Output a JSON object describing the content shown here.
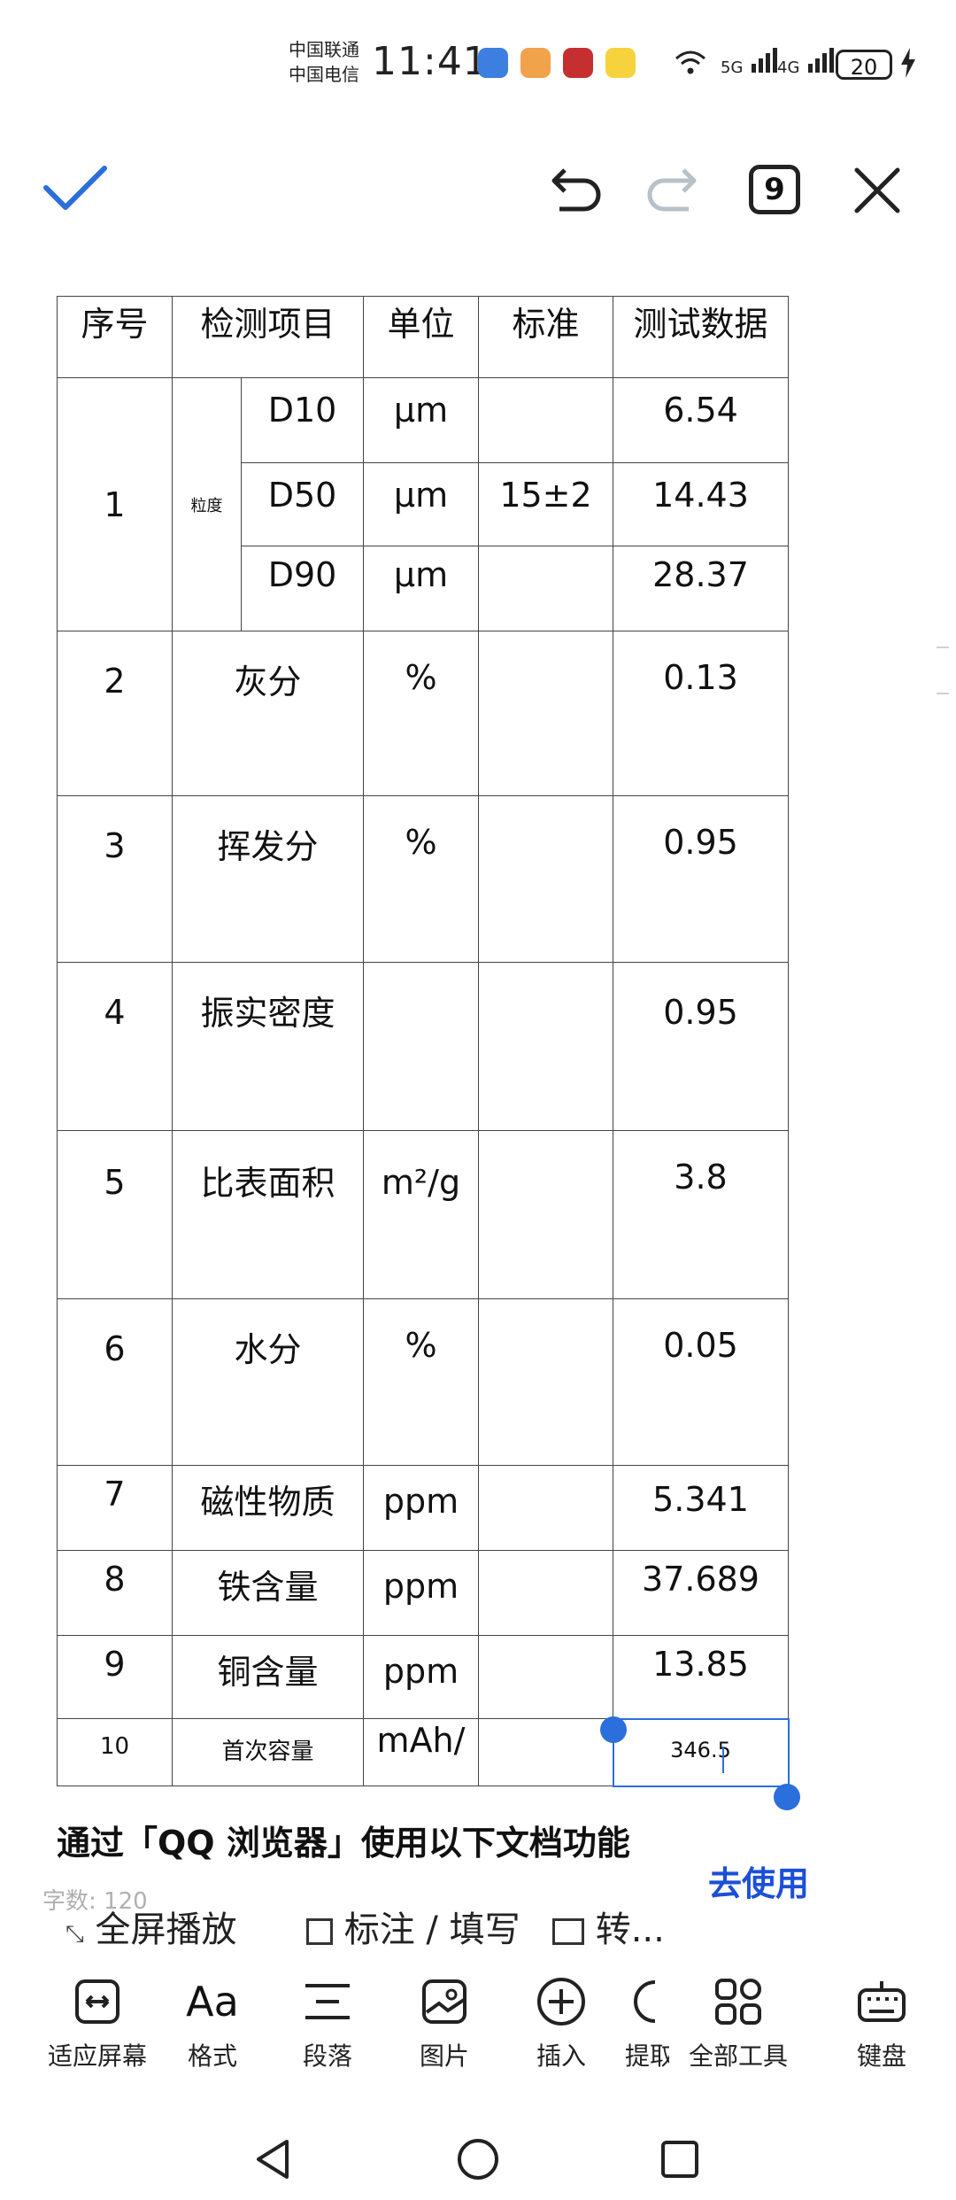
{
  "status": {
    "carrier1": "中国联通",
    "carrier2": "中国电信",
    "time": "11:41",
    "net1": "5G",
    "net2": "4G",
    "battery": "20"
  },
  "top": {
    "page_count": "9"
  },
  "table": {
    "header": [
      "序号",
      "检测项目",
      "单位",
      "标准",
      "测试数据"
    ],
    "particle_label": "粒度",
    "group1_no": "1",
    "particle_rows": [
      {
        "item": "D10",
        "unit": "μm",
        "std": "",
        "value": "6.54"
      },
      {
        "item": "D50",
        "unit": "μm",
        "std": "15±2",
        "value": "14.43"
      },
      {
        "item": "D90",
        "unit": "μm",
        "std": "",
        "value": "28.37"
      }
    ],
    "rows": [
      {
        "no": "2",
        "item": "灰分",
        "unit": "%",
        "std": "",
        "value": "0.13"
      },
      {
        "no": "3",
        "item": "挥发分",
        "unit": "%",
        "std": "",
        "value": "0.95"
      },
      {
        "no": "4",
        "item": "振实密度",
        "unit": "",
        "std": "",
        "value": "0.95"
      },
      {
        "no": "5",
        "item": "比表面积",
        "unit": "m²/g",
        "std": "",
        "value": "3.8"
      },
      {
        "no": "6",
        "item": "水分",
        "unit": "%",
        "std": "",
        "value": "0.05"
      },
      {
        "no": "7",
        "item": "磁性物质",
        "unit": "ppm",
        "std": "",
        "value": "5.341"
      },
      {
        "no": "8",
        "item": "铁含量",
        "unit": "ppm",
        "std": "",
        "value": "37.689"
      },
      {
        "no": "9",
        "item": "铜含量",
        "unit": "ppm",
        "std": "",
        "value": "13.85"
      },
      {
        "no": "10",
        "item": "首次容量",
        "unit": "mAh/",
        "std": "",
        "value": "346.5"
      }
    ]
  },
  "promo": {
    "text": "通过「QQ 浏览器」使用以下文档功能",
    "go": "去使用",
    "wordcount": "字数: 120",
    "fullscreen": "全屏播放",
    "annotate": "标注 / 填写",
    "convert": "转..."
  },
  "toolbar": [
    {
      "label": "适应屏幕",
      "icon": "fit-screen-icon"
    },
    {
      "label": "格式",
      "icon": "format-icon"
    },
    {
      "label": "段落",
      "icon": "paragraph-icon"
    },
    {
      "label": "图片",
      "icon": "image-icon"
    },
    {
      "label": "插入",
      "icon": "insert-icon"
    },
    {
      "label": "提取",
      "icon": "extract-icon"
    },
    {
      "label": "全部工具",
      "icon": "all-tools-icon"
    },
    {
      "label": "键盘",
      "icon": "keyboard-icon"
    }
  ],
  "colors": {
    "accent": "#2a6fdb",
    "link": "#1c4fd8"
  }
}
